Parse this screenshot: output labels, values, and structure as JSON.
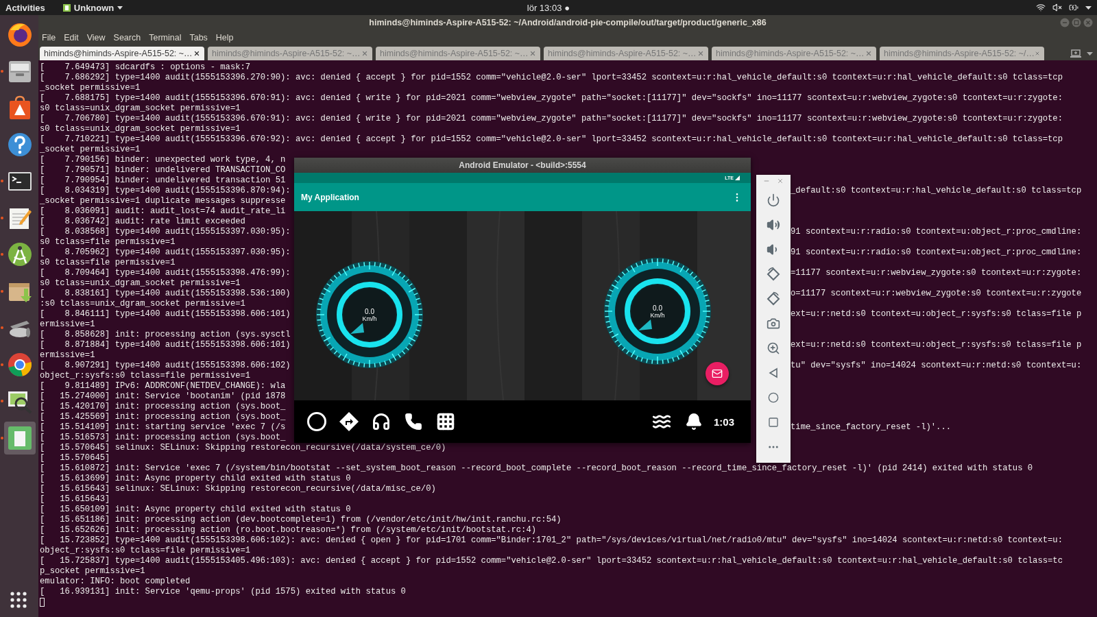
{
  "top_bar": {
    "activities": "Activities",
    "app_menu": "Unknown",
    "clock": "lör 13:03",
    "indicator": "●"
  },
  "dock": {
    "items": [
      {
        "kind": "firefox",
        "running": false,
        "selected": false
      },
      {
        "kind": "files",
        "running": true,
        "selected": false
      },
      {
        "kind": "software",
        "running": false,
        "selected": false
      },
      {
        "kind": "help",
        "running": false,
        "selected": false
      },
      {
        "kind": "terminal",
        "running": true,
        "selected": false
      },
      {
        "kind": "editor",
        "running": true,
        "selected": false
      },
      {
        "kind": "android",
        "running": true,
        "selected": false
      },
      {
        "kind": "archive",
        "running": true,
        "selected": false
      },
      {
        "kind": "scanner",
        "running": true,
        "selected": false
      },
      {
        "kind": "chrome",
        "running": true,
        "selected": false
      },
      {
        "kind": "viewer",
        "running": true,
        "selected": false
      },
      {
        "kind": "app",
        "running": true,
        "selected": true
      }
    ]
  },
  "terminal": {
    "title": "himinds@himinds-Aspire-A515-52: ~/Android/android-pie-compile/out/target/product/generic_x86",
    "menu": [
      "File",
      "Edit",
      "View",
      "Search",
      "Terminal",
      "Tabs",
      "Help"
    ],
    "tabs": [
      {
        "label": "himinds@himinds-Aspire-A515-52: ~…",
        "selected": true
      },
      {
        "label": "himinds@himinds-Aspire-A515-52: ~…",
        "selected": false
      },
      {
        "label": "himinds@himinds-Aspire-A515-52: ~…",
        "selected": false
      },
      {
        "label": "himinds@himinds-Aspire-A515-52: ~…",
        "selected": false
      },
      {
        "label": "himinds@himinds-Aspire-A515-52: ~…",
        "selected": false
      },
      {
        "label": "himinds@himinds-Aspire-A515-52: ~/…",
        "selected": false
      }
    ],
    "lines": [
      {
        "text": "[    7.649473] sdcardfs : options - mask:7"
      },
      {
        "text": "[    7.686292] type=1400 audit(1555153396.270:90): avc: denied { accept } for pid=1552 comm=\"vehicle@2.0-ser\" lport=33452 scontext=u:r:hal_vehicle_default:s0 tcontext=u:r:hal_vehicle_default:s0 tclass=tcp"
      },
      {
        "text": "_socket permissive=1"
      },
      {
        "text": "[    7.688175] type=1400 audit(1555153396.670:91): avc: denied { write } for pid=2021 comm=\"webview_zygote\" path=\"socket:[11177]\" dev=\"sockfs\" ino=11177 scontext=u:r:webview_zygote:s0 tcontext=u:r:zygote:"
      },
      {
        "text": "s0 tclass=unix_dgram_socket permissive=1"
      },
      {
        "text": "[    7.706780] type=1400 audit(1555153396.670:91): avc: denied { write } for pid=2021 comm=\"webview_zygote\" path=\"socket:[11177]\" dev=\"sockfs\" ino=11177 scontext=u:r:webview_zygote:s0 tcontext=u:r:zygote:"
      },
      {
        "text": "s0 tclass=unix_dgram_socket permissive=1"
      },
      {
        "text": "[    7.710221] type=1400 audit(1555153396.670:92): avc: denied { accept } for pid=1552 comm=\"vehicle@2.0-ser\" lport=33452 scontext=u:r:hal_vehicle_default:s0 tcontext=u:r:hal_vehicle_default:s0 tclass=tcp"
      },
      {
        "text": "_socket permissive=1"
      },
      {
        "text": "[    7.790156] binder: unexpected work type, 4, n"
      },
      {
        "text": "[    7.790571] binder: undelivered TRANSACTION_CO"
      },
      {
        "text": "[    7.790954] binder: undelivered transaction 51"
      },
      {
        "text": "[    8.034319] type=1400 audit(1555153396.870:94):",
        "tail": "_default:s0 tcontext=u:r:hal_vehicle_default:s0 tclass=tcp"
      },
      {
        "text": "_socket permissive=1 duplicate messages suppresse"
      },
      {
        "text": "[    8.036091] audit: audit_lost=74 audit_rate_li"
      },
      {
        "text": "[    8.036742] audit: rate limit exceeded"
      },
      {
        "text": "[    8.038568] type=1400 audit(1555153397.030:95):",
        "tail": "91 scontext=u:r:radio:s0 tcontext=u:object_r:proc_cmdline:"
      },
      {
        "text": "s0 tclass=file permissive=1"
      },
      {
        "text": "[    8.705962] type=1400 audit(1555153397.030:95):",
        "tail": "91 scontext=u:r:radio:s0 tcontext=u:object_r:proc_cmdline:"
      },
      {
        "text": "s0 tclass=file permissive=1"
      },
      {
        "text": "[    8.709464] type=1400 audit(1555153398.476:99):",
        "tail": "=11177 scontext=u:r:webview_zygote:s0 tcontext=u:r:zygote:"
      },
      {
        "text": "s0 tclass=unix_dgram_socket permissive=1"
      },
      {
        "text": "[    8.838161] type=1400 audit(1555153398.536:100)",
        "tail": "o=11177 scontext=u:r:webview_zygote:s0 tcontext=u:r:zygote"
      },
      {
        "text": ":s0 tclass=unix_dgram_socket permissive=1"
      },
      {
        "text": "[    8.846111] type=1400 audit(1555153398.606:101)",
        "tail": "ext=u:r:netd:s0 tcontext=u:object_r:sysfs:s0 tclass=file p"
      },
      {
        "text": "ermissive=1"
      },
      {
        "text": "[    8.858628] init: processing action (sys.sysctl"
      },
      {
        "text": "[    8.871884] type=1400 audit(1555153398.606:101)",
        "tail": "ext=u:r:netd:s0 tcontext=u:object_r:sysfs:s0 tclass=file p"
      },
      {
        "text": "ermissive=1"
      },
      {
        "text": "[    8.907291] type=1400 audit(1555153398.606:102)",
        "tail": "tu\" dev=\"sysfs\" ino=14024 scontext=u:r:netd:s0 tcontext=u:"
      },
      {
        "text": "object_r:sysfs:s0 tclass=file permissive=1"
      },
      {
        "text": "[    9.811489] IPv6: ADDRCONF(NETDEV_CHANGE): wla"
      },
      {
        "text": "[   15.274000] init: Service 'bootanim' (pid 1878"
      },
      {
        "text": "[   15.420170] init: processing action (sys.boot_"
      },
      {
        "text": "[   15.425569] init: processing action (sys.boot_"
      },
      {
        "text": "[   15.514109] init: starting service 'exec 7 (/s",
        "tail": "time_since_factory_reset -l)'..."
      },
      {
        "text": "[   15.516573] init: processing action (sys.boot_"
      },
      {
        "text": "[   15.570645] selinux: SELinux: Skipping restorecon_recursive(/data/system_ce/0)"
      },
      {
        "text": "[   15.570645]"
      },
      {
        "text": "[   15.610872] init: Service 'exec 7 (/system/bin/bootstat --set_system_boot_reason --record_boot_complete --record_boot_reason --record_time_since_factory_reset -l)' (pid 2414) exited with status 0"
      },
      {
        "text": "[   15.613699] init: Async property child exited with status 0"
      },
      {
        "text": "[   15.615643] selinux: SELinux: Skipping restorecon_recursive(/data/misc_ce/0)"
      },
      {
        "text": "[   15.615643]"
      },
      {
        "text": "[   15.650109] init: Async property child exited with status 0"
      },
      {
        "text": "[   15.651186] init: processing action (dev.bootcomplete=1) from (/vendor/etc/init/hw/init.ranchu.rc:54)"
      },
      {
        "text": "[   15.652626] init: processing action (ro.boot.bootreason=*) from (/system/etc/init/bootstat.rc:4)"
      },
      {
        "text": "[   15.723852] type=1400 audit(1555153398.606:102): avc: denied { open } for pid=1701 comm=\"Binder:1701_2\" path=\"/sys/devices/virtual/net/radio0/mtu\" dev=\"sysfs\" ino=14024 scontext=u:r:netd:s0 tcontext=u:"
      },
      {
        "text": "object_r:sysfs:s0 tclass=file permissive=1"
      },
      {
        "text": "[   15.725837] type=1400 audit(1555153405.496:103): avc: denied { accept } for pid=1552 comm=\"vehicle@2.0-ser\" lport=33452 scontext=u:r:hal_vehicle_default:s0 tcontext=u:r:hal_vehicle_default:s0 tclass=tc"
      },
      {
        "text": "p_socket permissive=1"
      },
      {
        "text": "emulator: INFO: boot completed"
      },
      {
        "text": "[   16.939131] init: Service 'qemu-props' (pid 1575) exited with status 0"
      }
    ],
    "cursor_visible": true
  },
  "emulator": {
    "title": "Android Emulator - <build>:5554",
    "network": "LTE",
    "app_title": "My Application",
    "gauges": [
      {
        "value": "0.0",
        "unit": "Km/h"
      },
      {
        "value": "0.0",
        "unit": "Km/h"
      }
    ],
    "nav_left": [
      {
        "kind": "circle"
      },
      {
        "kind": "directions"
      },
      {
        "kind": "headphones"
      },
      {
        "kind": "phone"
      },
      {
        "kind": "apps"
      }
    ],
    "nav_right": [
      {
        "kind": "waves"
      },
      {
        "kind": "bell"
      }
    ],
    "time": "1:03"
  },
  "emulator_panel": {
    "buttons": [
      {
        "kind": "power"
      },
      {
        "kind": "volume_up"
      },
      {
        "kind": "volume_down"
      },
      {
        "kind": "rotate_left"
      },
      {
        "kind": "rotate_right"
      },
      {
        "kind": "camera"
      },
      {
        "kind": "zoom"
      },
      {
        "kind": "back"
      },
      {
        "kind": "home"
      },
      {
        "kind": "overview"
      },
      {
        "kind": "more"
      }
    ]
  }
}
